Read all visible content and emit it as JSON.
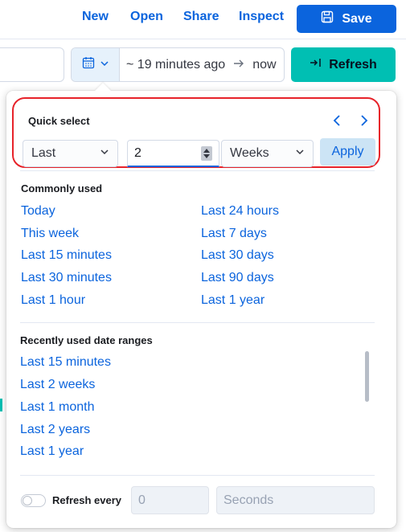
{
  "nav": {
    "new": "New",
    "open": "Open",
    "share": "Share",
    "inspect": "Inspect",
    "save": "Save"
  },
  "date_picker": {
    "start": "~ 19 minutes ago",
    "end": "now",
    "refresh": "Refresh"
  },
  "quick_select": {
    "title": "Quick select",
    "direction": "Last",
    "value": "2",
    "unit": "Weeks",
    "apply": "Apply"
  },
  "commonly_used": {
    "title": "Commonly used",
    "left": [
      "Today",
      "This week",
      "Last 15 minutes",
      "Last 30 minutes",
      "Last 1 hour"
    ],
    "right": [
      "Last 24 hours",
      "Last 7 days",
      "Last 30 days",
      "Last 90 days",
      "Last 1 year"
    ]
  },
  "recently_used": {
    "title": "Recently used date ranges",
    "items": [
      "Last 15 minutes",
      "Last 2 weeks",
      "Last 1 month",
      "Last 2 years",
      "Last 1 year"
    ]
  },
  "refresh_every": {
    "label": "Refresh every",
    "value_placeholder": "0",
    "unit_placeholder": "Seconds"
  },
  "colors": {
    "primary": "#0b64dd",
    "accent": "#00bfb3",
    "highlight": "#e7232a"
  },
  "icons": [
    "save-icon",
    "calendar-icon",
    "chevron-down-icon",
    "arrow-right-icon",
    "refresh-arrow-icon",
    "chevron-left-icon",
    "chevron-right-icon"
  ]
}
